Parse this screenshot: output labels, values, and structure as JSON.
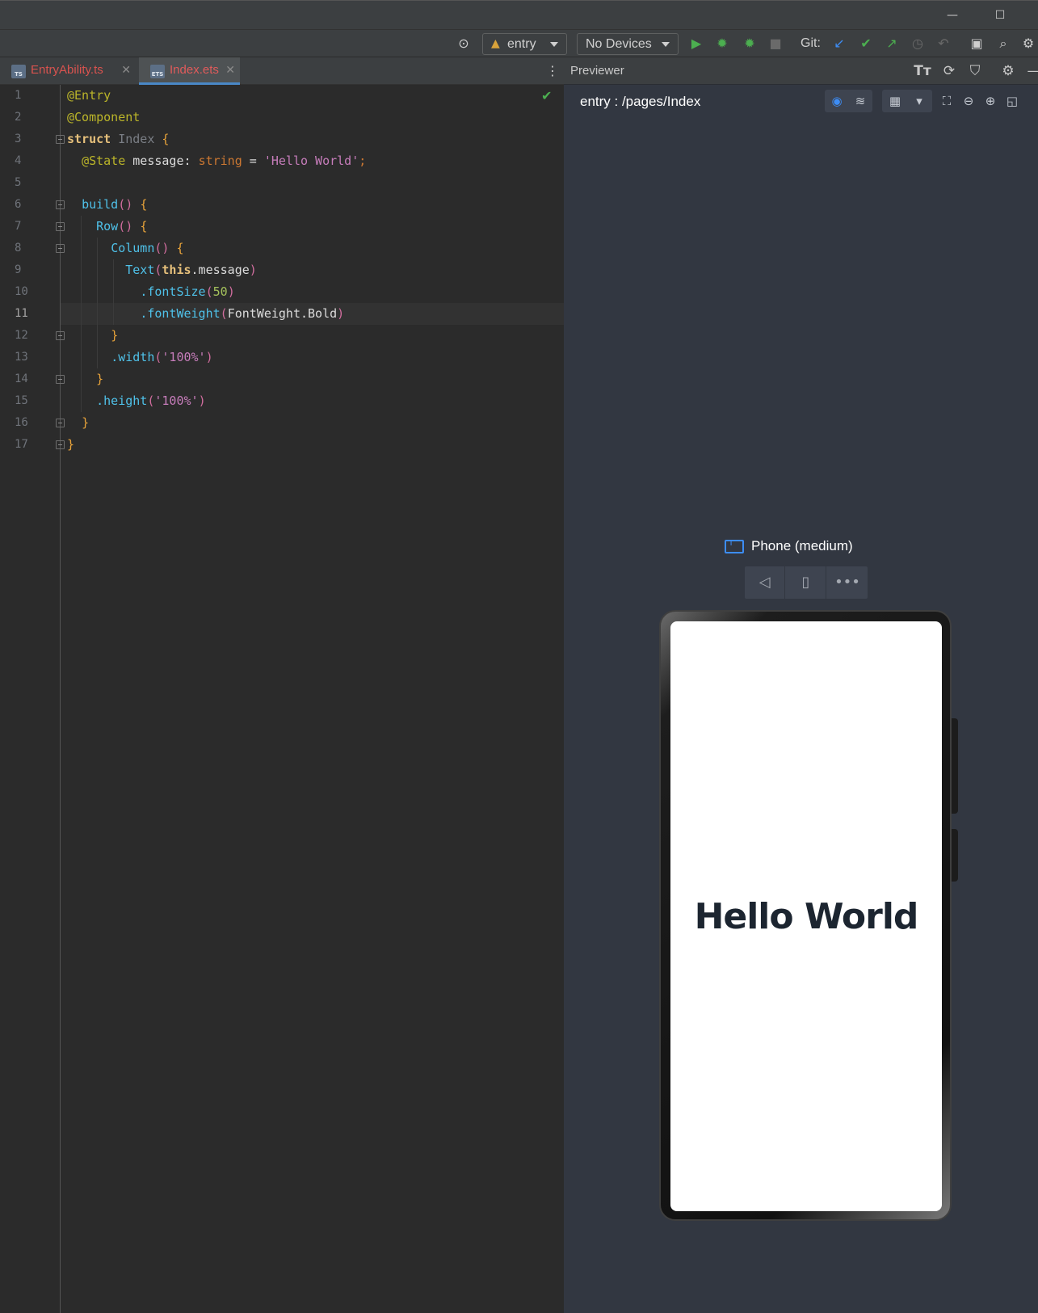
{
  "window": {
    "minimize_glyph": "—",
    "maximize_glyph": "☐"
  },
  "toolbar": {
    "module_combo": "entry",
    "device_combo": "No Devices",
    "git_label": "Git:"
  },
  "editor": {
    "tabs": [
      {
        "label": "EntryAbility.ts",
        "icon": "TS",
        "active": false,
        "color": "#d9534f"
      },
      {
        "label": "Index.ets",
        "icon": "ETS",
        "active": true,
        "color": "#e05b5b"
      }
    ],
    "current_line": 11,
    "line_numbers": [
      "1",
      "2",
      "3",
      "4",
      "5",
      "6",
      "7",
      "8",
      "9",
      "10",
      "11",
      "12",
      "13",
      "14",
      "15",
      "16",
      "17"
    ],
    "lines": [
      [
        {
          "t": "@Entry",
          "c": "c-ann"
        }
      ],
      [
        {
          "t": "@Component",
          "c": "c-ann"
        }
      ],
      [
        {
          "t": "struct",
          "c": "c-kwb"
        },
        {
          "t": " ",
          "c": ""
        },
        {
          "t": "Index",
          "c": "c-cls"
        },
        {
          "t": " ",
          "c": ""
        },
        {
          "t": "{",
          "c": "c-brace"
        }
      ],
      [
        {
          "t": "  ",
          "c": ""
        },
        {
          "t": "@State",
          "c": "c-ann"
        },
        {
          "t": " message",
          "c": "c-id"
        },
        {
          "t": ": ",
          "c": "c-id"
        },
        {
          "t": "string",
          "c": "c-type"
        },
        {
          "t": " = ",
          "c": "c-id"
        },
        {
          "t": "'Hello World'",
          "c": "c-str"
        },
        {
          "t": ";",
          "c": "c-type"
        }
      ],
      [],
      [
        {
          "t": "  ",
          "c": ""
        },
        {
          "t": "build",
          "c": "c-prop"
        },
        {
          "t": "()",
          "c": "c-paren"
        },
        {
          "t": " ",
          "c": ""
        },
        {
          "t": "{",
          "c": "c-brace"
        }
      ],
      [
        {
          "t": "    ",
          "c": ""
        },
        {
          "t": "Row",
          "c": "c-prop"
        },
        {
          "t": "()",
          "c": "c-paren"
        },
        {
          "t": " ",
          "c": ""
        },
        {
          "t": "{",
          "c": "c-brace"
        }
      ],
      [
        {
          "t": "      ",
          "c": ""
        },
        {
          "t": "Column",
          "c": "c-prop"
        },
        {
          "t": "()",
          "c": "c-paren"
        },
        {
          "t": " ",
          "c": ""
        },
        {
          "t": "{",
          "c": "c-brace"
        }
      ],
      [
        {
          "t": "        ",
          "c": ""
        },
        {
          "t": "Text",
          "c": "c-prop"
        },
        {
          "t": "(",
          "c": "c-paren"
        },
        {
          "t": "this",
          "c": "c-kwb"
        },
        {
          "t": ".message",
          "c": "c-id"
        },
        {
          "t": ")",
          "c": "c-paren"
        }
      ],
      [
        {
          "t": "          ",
          "c": ""
        },
        {
          "t": ".fontSize",
          "c": "c-prop"
        },
        {
          "t": "(",
          "c": "c-paren"
        },
        {
          "t": "50",
          "c": "c-num"
        },
        {
          "t": ")",
          "c": "c-paren"
        }
      ],
      [
        {
          "t": "          ",
          "c": ""
        },
        {
          "t": ".fontWeight",
          "c": "c-prop"
        },
        {
          "t": "(",
          "c": "c-paren"
        },
        {
          "t": "FontWeight.Bold",
          "c": "c-id"
        },
        {
          "t": ")",
          "c": "c-paren"
        }
      ],
      [
        {
          "t": "      ",
          "c": ""
        },
        {
          "t": "}",
          "c": "c-brace"
        }
      ],
      [
        {
          "t": "      ",
          "c": ""
        },
        {
          "t": ".width",
          "c": "c-prop"
        },
        {
          "t": "(",
          "c": "c-paren"
        },
        {
          "t": "'100%'",
          "c": "c-str"
        },
        {
          "t": ")",
          "c": "c-paren"
        }
      ],
      [
        {
          "t": "    ",
          "c": ""
        },
        {
          "t": "}",
          "c": "c-brace"
        }
      ],
      [
        {
          "t": "    ",
          "c": ""
        },
        {
          "t": ".height",
          "c": "c-prop"
        },
        {
          "t": "(",
          "c": "c-paren"
        },
        {
          "t": "'100%'",
          "c": "c-str"
        },
        {
          "t": ")",
          "c": "c-paren"
        }
      ],
      [
        {
          "t": "  ",
          "c": ""
        },
        {
          "t": "}",
          "c": "c-brace"
        }
      ],
      [
        {
          "t": "}",
          "c": "c-brace"
        }
      ]
    ]
  },
  "previewer": {
    "title": "Previewer",
    "page_path": "entry : /pages/Index",
    "device_name": "Phone (medium)",
    "screen_text": "Hello World"
  }
}
